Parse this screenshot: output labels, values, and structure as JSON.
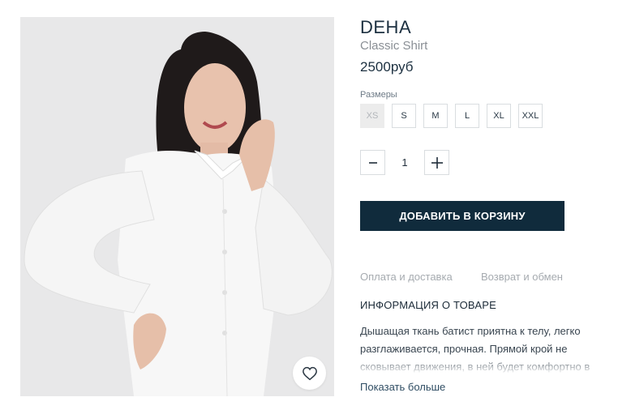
{
  "product": {
    "brand": "DEHA",
    "name": "Classic Shirt",
    "price": "2500руб"
  },
  "sizes": {
    "label": "Размеры",
    "options": [
      {
        "label": "XS",
        "available": false
      },
      {
        "label": "S",
        "available": true
      },
      {
        "label": "M",
        "available": true
      },
      {
        "label": "L",
        "available": true
      },
      {
        "label": "XL",
        "available": true
      },
      {
        "label": "XXL",
        "available": true
      }
    ]
  },
  "quantity": {
    "value": "1",
    "minus_icon": "minus-icon",
    "plus_icon": "plus-icon"
  },
  "cart": {
    "label": "ДОБАВИТЬ В КОРЗИНУ",
    "color": "#102b3c"
  },
  "tabs": [
    {
      "label": "Оплата и доставка"
    },
    {
      "label": "Возврат и обмен"
    }
  ],
  "info": {
    "title": "ИНФОРМАЦИЯ О ТОВАРЕ",
    "description": "Дышащая ткань батист приятна к телу, легко разглаживается, прочная. Прямой крой не сковывает движения, в ней будет комфортно в",
    "show_more": "Показать больше"
  },
  "favorite": {
    "icon": "heart-icon"
  }
}
